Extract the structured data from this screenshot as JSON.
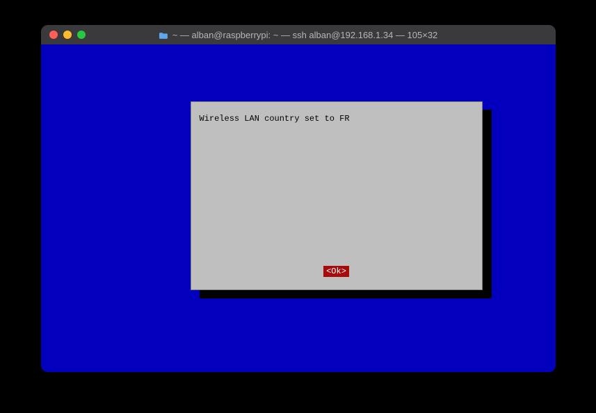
{
  "window": {
    "title": "~ — alban@raspberrypi: ~ — ssh alban@192.168.1.34 — 105×32",
    "traffic": {
      "close": "close",
      "minimize": "minimize",
      "zoom": "zoom"
    }
  },
  "dialog": {
    "message": "Wireless LAN country set to FR",
    "ok_label": "<Ok>"
  }
}
